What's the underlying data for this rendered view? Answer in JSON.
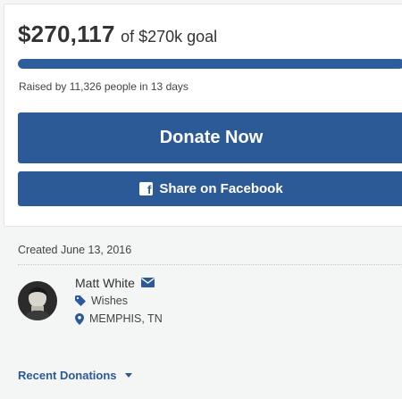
{
  "campaign": {
    "raised_amount": "$270,117",
    "goal_text": "of $270k goal",
    "progress_fraction": 1.0,
    "raised_by_text": "Raised by 11,326 people in 13 days"
  },
  "actions": {
    "donate_label": "Donate Now",
    "share_label": "Share on Facebook",
    "share_icon": "f"
  },
  "details": {
    "created_text": "Created June 13, 2016",
    "organizer_name": "Matt White",
    "category": "Wishes",
    "location": "MEMPHIS, TN"
  },
  "recent": {
    "label": "Recent Donations"
  },
  "colors": {
    "brand": "#2c5a96",
    "progress": "#2d5d9c"
  },
  "icons": {
    "share": "facebook-icon",
    "contact": "envelope-icon",
    "category": "tag-icon",
    "location": "map-pin-icon",
    "dropdown": "caret-down-icon"
  }
}
